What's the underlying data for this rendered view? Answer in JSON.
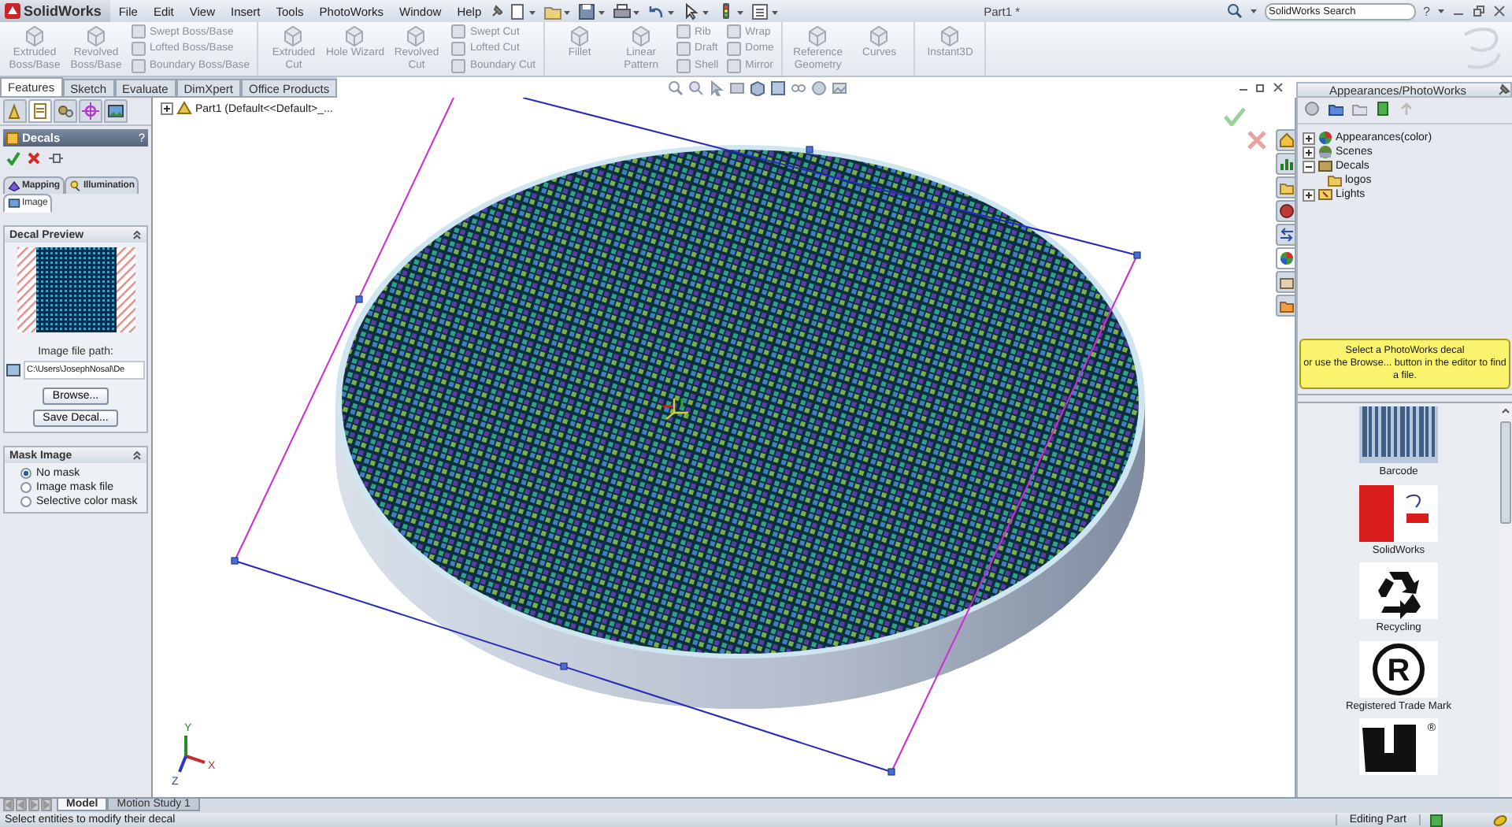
{
  "titlebar": {
    "app_name": "SolidWorks",
    "menus": [
      "File",
      "Edit",
      "View",
      "Insert",
      "Tools",
      "PhotoWorks",
      "Window",
      "Help"
    ],
    "document_title": "Part1 *",
    "search": {
      "value": "SolidWorks Search"
    },
    "help": "?"
  },
  "ribbon": {
    "groups": [
      {
        "items": [
          {
            "kind": "big",
            "label": "Extruded Boss/Base",
            "disabled": true
          },
          {
            "kind": "big",
            "label": "Revolved Boss/Base",
            "disabled": true
          },
          {
            "kind": "stack",
            "items": [
              {
                "label": "Swept Boss/Base",
                "disabled": true
              },
              {
                "label": "Lofted Boss/Base",
                "disabled": true
              },
              {
                "label": "Boundary Boss/Base",
                "disabled": true
              }
            ]
          }
        ]
      },
      {
        "items": [
          {
            "kind": "big",
            "label": "Extruded Cut",
            "disabled": true
          },
          {
            "kind": "big",
            "label": "Hole Wizard",
            "disabled": true
          },
          {
            "kind": "big",
            "label": "Revolved Cut",
            "disabled": true
          },
          {
            "kind": "stack",
            "items": [
              {
                "label": "Swept Cut",
                "disabled": true
              },
              {
                "label": "Lofted Cut",
                "disabled": true
              },
              {
                "label": "Boundary Cut",
                "disabled": true
              }
            ]
          }
        ]
      },
      {
        "items": [
          {
            "kind": "big",
            "label": "Fillet",
            "disabled": true
          },
          {
            "kind": "big",
            "label": "Linear Pattern",
            "disabled": true
          },
          {
            "kind": "stack",
            "items": [
              {
                "label": "Rib",
                "disabled": true
              },
              {
                "label": "Draft",
                "disabled": true
              },
              {
                "label": "Shell",
                "disabled": true
              }
            ]
          },
          {
            "kind": "stack",
            "items": [
              {
                "label": "Wrap",
                "disabled": true
              },
              {
                "label": "Dome",
                "disabled": true
              },
              {
                "label": "Mirror",
                "disabled": true
              }
            ]
          }
        ]
      },
      {
        "items": [
          {
            "kind": "big",
            "label": "Reference Geometry",
            "disabled": true
          },
          {
            "kind": "big",
            "label": "Curves",
            "disabled": true
          }
        ]
      },
      {
        "items": [
          {
            "kind": "big",
            "label": "Instant3D",
            "disabled": true
          }
        ]
      }
    ]
  },
  "command_tabs": [
    {
      "label": "Features",
      "selected": true
    },
    {
      "label": "Sketch",
      "selected": false
    },
    {
      "label": "Evaluate",
      "selected": false
    },
    {
      "label": "DimXpert",
      "selected": false
    },
    {
      "label": "Office Products",
      "selected": false
    }
  ],
  "property_manager": {
    "icon_tabs": [
      {
        "selected": false
      },
      {
        "selected": true
      },
      {
        "selected": false
      },
      {
        "selected": false
      },
      {
        "selected": false
      }
    ],
    "title": "Decals",
    "help": "?",
    "tabs": [
      {
        "label": "Mapping",
        "selected": false
      },
      {
        "label": "Illumination",
        "selected": false
      },
      {
        "label": "Image",
        "selected": true
      }
    ],
    "decal_preview": {
      "title": "Decal Preview",
      "path_label": "Image file path:",
      "path_value": "C:\\Users\\JosephNosal\\De",
      "buttons": [
        "Browse...",
        "Save Decal..."
      ]
    },
    "mask_image": {
      "title": "Mask Image",
      "options": [
        {
          "label": "No mask",
          "selected": true
        },
        {
          "label": "Image mask file",
          "selected": false
        },
        {
          "label": "Selective color mask",
          "selected": false
        }
      ]
    }
  },
  "viewport": {
    "tree_item": "Part1 (Default<<Default>_...",
    "triad_labels": [
      "X",
      "Y",
      "Z"
    ]
  },
  "task_pane_tabs": [
    {
      "selected": false
    },
    {
      "selected": false
    },
    {
      "selected": false
    },
    {
      "selected": false
    },
    {
      "selected": false
    },
    {
      "selected": true
    },
    {
      "selected": false
    },
    {
      "selected": false
    }
  ],
  "task_pane": {
    "title": "Appearances/PhotoWorks",
    "tree": [
      {
        "label": "Appearances(color)",
        "expanded": false
      },
      {
        "label": "Scenes",
        "expanded": false
      },
      {
        "label": "Decals",
        "expanded": true,
        "children": [
          {
            "label": "logos"
          }
        ]
      },
      {
        "label": "Lights",
        "expanded": false
      }
    ],
    "message": [
      "Select a PhotoWorks decal",
      "or use the Browse... button in the editor to find a file."
    ],
    "gallery": [
      {
        "kind": "barcode",
        "label": "Barcode"
      },
      {
        "kind": "logo",
        "label": "SolidWorks"
      },
      {
        "kind": "recycle",
        "label": "Recycling"
      },
      {
        "kind": "registered",
        "label": "Registered Trade Mark",
        "symbol": "R"
      },
      {
        "kind": "mark",
        "symbol": "®"
      }
    ]
  },
  "bottom_tabs": [
    {
      "label": "Model",
      "selected": true
    },
    {
      "label": "Motion Study 1",
      "selected": false
    }
  ],
  "status_bar": {
    "message": "Select entities to modify their decal",
    "mode": "Editing Part"
  }
}
